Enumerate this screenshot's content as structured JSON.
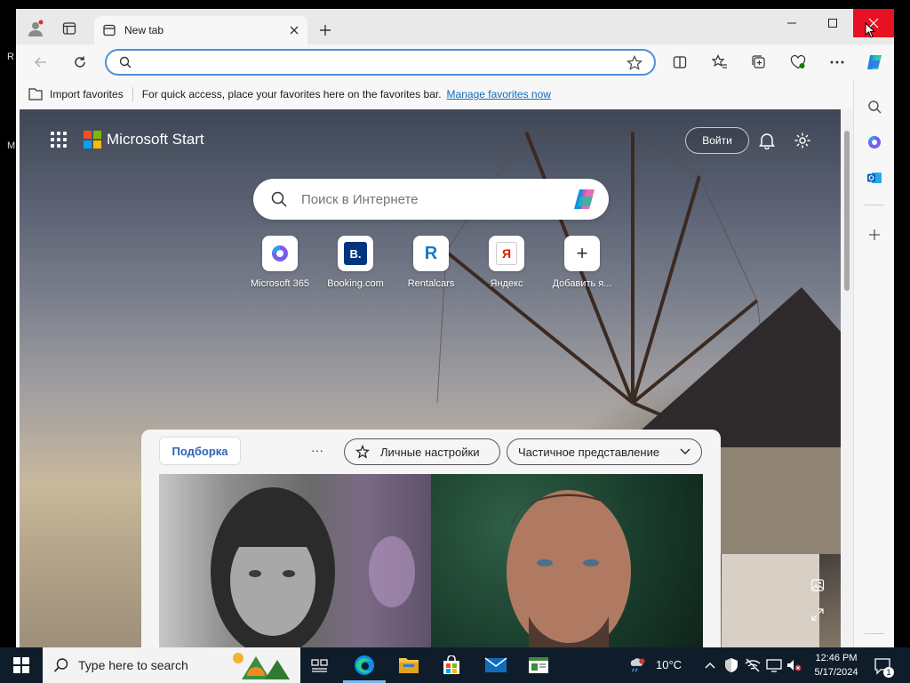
{
  "browser": {
    "tab_title": "New tab",
    "address_placeholder": "",
    "favorites_bar": {
      "import_label": "Import favorites",
      "message": "For quick access, place your favorites here on the favorites bar.",
      "manage_link": "Manage favorites now"
    }
  },
  "page": {
    "brand": "Microsoft Start",
    "signin_label": "Войти",
    "search_placeholder": "Поиск в Интернете",
    "quick_links": [
      {
        "label": "Microsoft 365",
        "icon": "m365-icon"
      },
      {
        "label": "Booking.com",
        "icon": "booking-icon",
        "glyph": "B."
      },
      {
        "label": "Rentalcars",
        "icon": "rentalcars-icon",
        "glyph": "R"
      },
      {
        "label": "Яндекс",
        "icon": "yandex-icon",
        "glyph": "Я"
      },
      {
        "label": "Добавить я...",
        "icon": "plus-icon",
        "glyph": "+"
      }
    ],
    "feed": {
      "active_tab": "Подборка",
      "more": "···",
      "personalize": "Личные настройки",
      "view_mode": "Частичное представление"
    }
  },
  "taskbar": {
    "search_placeholder": "Type here to search",
    "temperature": "10°C",
    "time": "12:46 PM",
    "date": "5/17/2024",
    "notification_count": "1"
  },
  "desktop": {
    "left_glyphs": [
      "R",
      "M"
    ]
  },
  "colors": {
    "accent": "#0f6cbd",
    "close_red": "#e81123",
    "taskbar": "#0f1d2b",
    "feed_tab_text": "#2f63b8"
  }
}
